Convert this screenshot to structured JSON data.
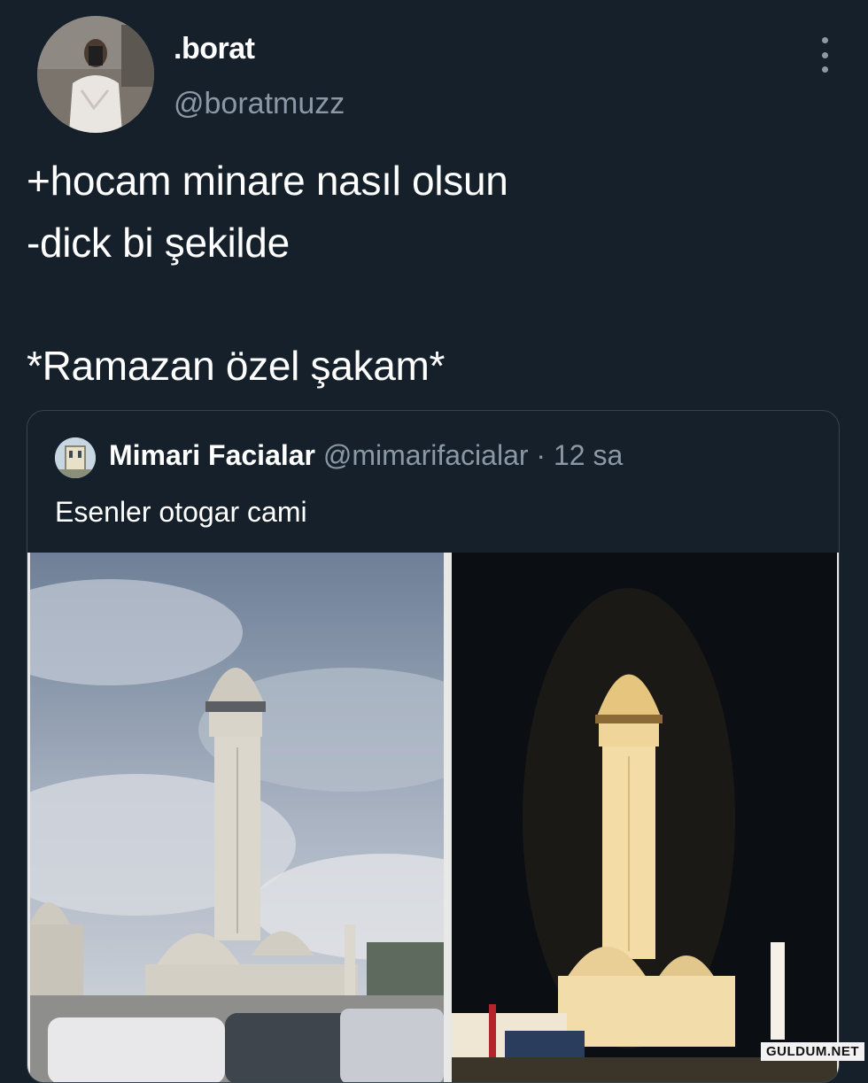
{
  "tweet": {
    "display_name": ".borat",
    "handle": "@boratmuzz",
    "lines": [
      "+hocam minare nasıl olsun",
      "-dick bi şekilde",
      "*Ramazan özel şakam*"
    ]
  },
  "quoted_tweet": {
    "display_name": "Mimari Facialar",
    "handle": "@mimarifacialar",
    "separator": "·",
    "time": "12 sa",
    "text": "Esenler otogar cami"
  },
  "icons": {
    "more": "more-vertical-icon",
    "scroll_up": "chevron-up-icon",
    "scroll_down": "chevron-down-icon"
  },
  "watermark": "GULDUM.NET",
  "colors": {
    "background": "#15202b",
    "secondary_text": "#8b98a5",
    "border": "#38444d"
  }
}
